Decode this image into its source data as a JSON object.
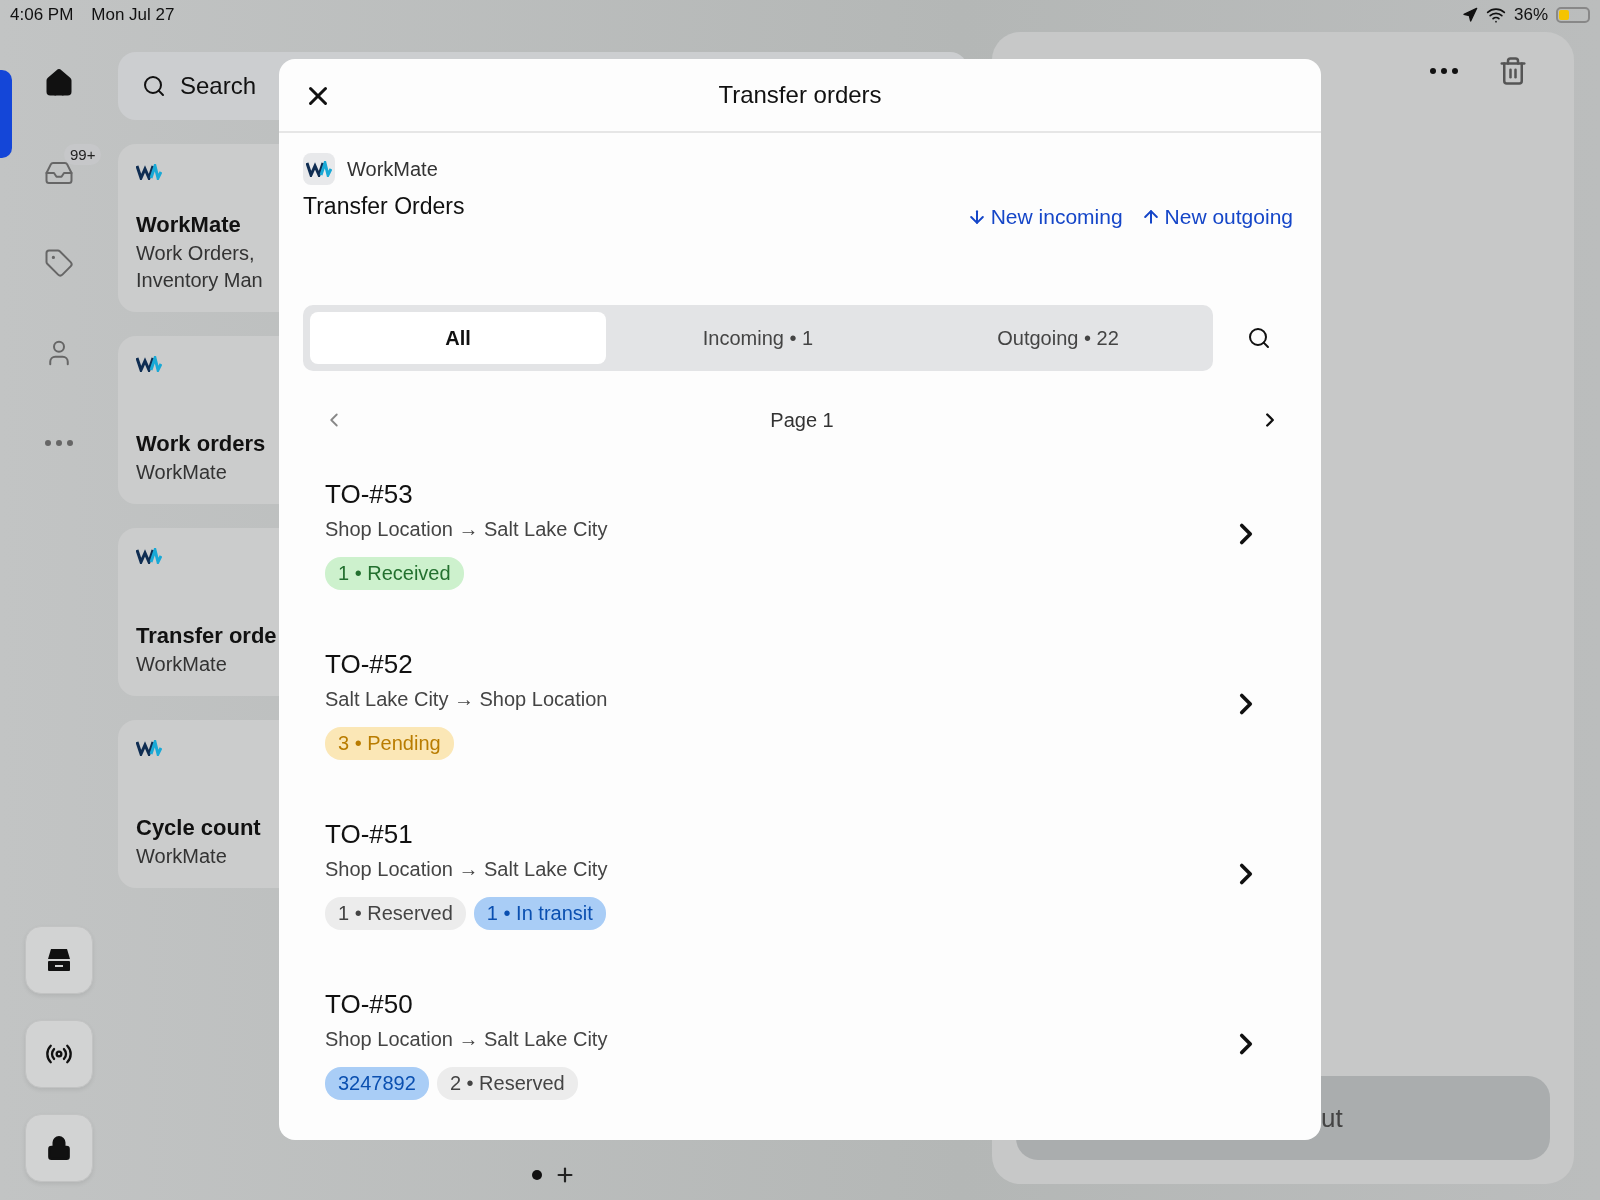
{
  "status_bar": {
    "time": "4:06 PM",
    "date": "Mon Jul 27",
    "battery": "36%"
  },
  "rail": {
    "items": [
      {
        "kind": "home",
        "selected": true
      },
      {
        "kind": "inbox",
        "selected": false,
        "badge": "99+"
      },
      {
        "kind": "tag",
        "selected": false
      },
      {
        "kind": "person",
        "selected": false
      },
      {
        "kind": "more",
        "selected": false
      }
    ],
    "bottom_buttons": [
      {
        "kind": "drawer"
      },
      {
        "kind": "broadcast"
      },
      {
        "kind": "lock"
      }
    ]
  },
  "search": {
    "placeholder": "Search"
  },
  "cards": [
    {
      "title": "WorkMate",
      "lines": [
        "Work Orders,",
        "Inventory Man"
      ]
    },
    {
      "title": "Work orders",
      "lines": [
        "WorkMate"
      ]
    },
    {
      "title": "Transfer orde",
      "lines": [
        "WorkMate"
      ]
    },
    {
      "title": "Cycle count",
      "lines": [
        "WorkMate"
      ]
    }
  ],
  "right_panel": {
    "button": "ut"
  },
  "modal": {
    "title": "Transfer orders",
    "app_name": "WorkMate",
    "heading": "Transfer Orders",
    "actions": [
      {
        "kind": "down",
        "label": "New incoming"
      },
      {
        "kind": "up",
        "label": "New outgoing"
      }
    ],
    "tabs": [
      {
        "label": "All",
        "selected": true
      },
      {
        "label": "Incoming • 1",
        "selected": false
      },
      {
        "label": "Outgoing • 22",
        "selected": false
      }
    ],
    "pagination": {
      "label": "Page 1",
      "prev_disabled": true,
      "next_disabled": false
    },
    "orders": [
      {
        "id": "TO-#53",
        "route": "Shop Location → Salt Lake City",
        "tags": [
          {
            "label": "1 • Received",
            "kind": "success"
          }
        ]
      },
      {
        "id": "TO-#52",
        "route": "Salt Lake City → Shop Location",
        "tags": [
          {
            "label": "3 • Pending",
            "kind": "warning"
          }
        ]
      },
      {
        "id": "TO-#51",
        "route": "Shop Location → Salt Lake City",
        "tags": [
          {
            "label": "1 • Reserved",
            "kind": "neutral"
          },
          {
            "label": "1 • In transit",
            "kind": "info"
          }
        ]
      },
      {
        "id": "TO-#50",
        "route": "Shop Location → Salt Lake City",
        "tags": [
          {
            "label": "3247892",
            "kind": "info"
          },
          {
            "label": "2 • Reserved",
            "kind": "neutral"
          }
        ]
      }
    ]
  },
  "page_dots": [
    {
      "kind": "dot",
      "selected": true
    },
    {
      "kind": "plus",
      "selected": false
    }
  ]
}
